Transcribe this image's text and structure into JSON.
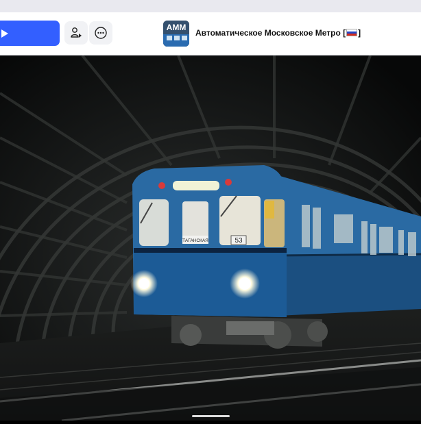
{
  "header": {
    "game_title": "Автоматическое Московское Метро [",
    "game_title_suffix": "]",
    "thumbnail_text": "AMM",
    "play_button_color": "#335fff",
    "icons": [
      "play-icon",
      "avatar-icon",
      "more-icon"
    ]
  },
  "scene": {
    "train_destination_sign": "ТАГАНСКАЯ",
    "train_number": "53",
    "train_body_color": "#1f5d92"
  },
  "colors": {
    "header_bg": "#ffffff",
    "accent": "#335fff",
    "flag": [
      "#ffffff",
      "#2346c7",
      "#d52b1e"
    ]
  }
}
